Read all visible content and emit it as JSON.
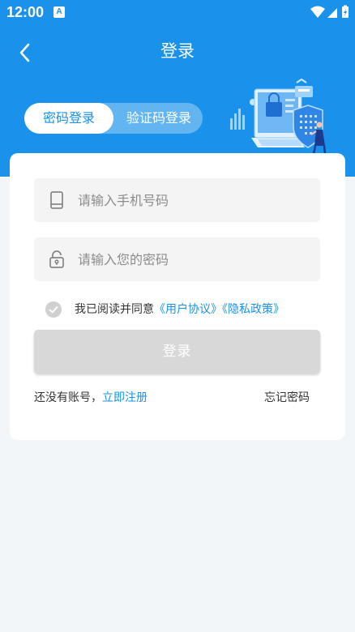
{
  "status_bar": {
    "time": "12:00",
    "notification_letter": "A"
  },
  "header": {
    "title": "登录"
  },
  "tabs": [
    {
      "label": "密码登录",
      "active": true
    },
    {
      "label": "验证码登录",
      "active": false
    }
  ],
  "form": {
    "phone_placeholder": "请输入手机号码",
    "password_placeholder": "请输入您的密码"
  },
  "agreement": {
    "prefix": "我已阅读并同意",
    "user_agreement": "《用户协议》",
    "privacy_policy": "《隐私政策》",
    "checked": false
  },
  "login_button": "登录",
  "register": {
    "prompt": "还没有账号，",
    "link": "立即注册"
  },
  "forgot_password": "忘记密码",
  "colors": {
    "primary": "#1a92ec",
    "background": "#f3f6f8",
    "button_disabled": "#d8d8d8",
    "input_bg": "#f4f4f4"
  }
}
